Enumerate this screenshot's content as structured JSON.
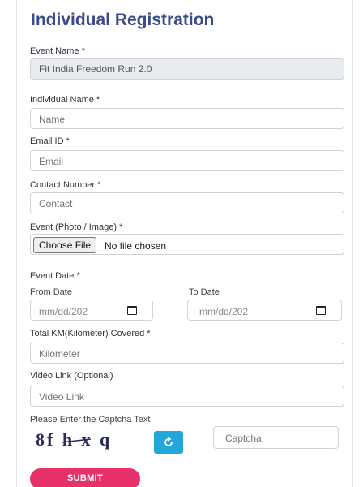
{
  "form": {
    "title": "Individual Registration",
    "event_name": {
      "label": "Event Name *",
      "value": "Fit India Freedom Run 2.0"
    },
    "individual_name": {
      "label": "Individual Name *",
      "placeholder": "Name"
    },
    "email": {
      "label": "Email ID *",
      "placeholder": "Email"
    },
    "contact": {
      "label": "Contact Number *",
      "placeholder": "Contact"
    },
    "photo": {
      "label": "Event (Photo / Image) *",
      "button": "Choose File",
      "status": "No file chosen"
    },
    "event_date": {
      "label": "Event Date *",
      "from_label": "From Date",
      "to_label": "To Date",
      "from_value": "mm/dd/202",
      "to_value": "mm/dd/202"
    },
    "km": {
      "label": "Total KM(Kilometer) Covered *",
      "placeholder": "Kilometer"
    },
    "video": {
      "label": "Video Link (Optional)",
      "placeholder": "Video Link"
    },
    "captcha": {
      "label": "Please Enter the Captcha Text",
      "image_text": "8f h x q",
      "refresh_icon": "refresh-icon",
      "placeholder": "Captcha"
    },
    "submit": "SUBMIT"
  },
  "colors": {
    "title": "#3a4a8a",
    "submit": "#e8306a",
    "refresh": "#22a7d9",
    "readonly_bg": "#e9ecef"
  }
}
